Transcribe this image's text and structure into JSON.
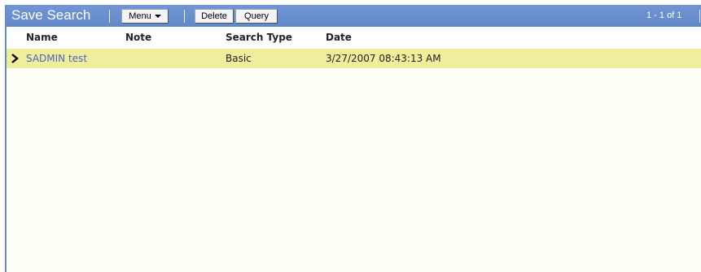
{
  "toolbar": {
    "title": "Save Search",
    "menu_label": "Menu",
    "delete_label": "Delete",
    "query_label": "Query",
    "record_count": "1 - 1 of 1"
  },
  "columns": [
    "Name",
    "Note",
    "Search Type",
    "Date"
  ],
  "rows": [
    {
      "name": "SADMIN test",
      "note": "",
      "search_type": "Basic",
      "date": "3/27/2007 08:43:13 AM"
    }
  ],
  "colors": {
    "toolbar_bg": "#6b8fd0",
    "selected_row_bg": "#eeee9c",
    "link_text": "#5060c0"
  }
}
